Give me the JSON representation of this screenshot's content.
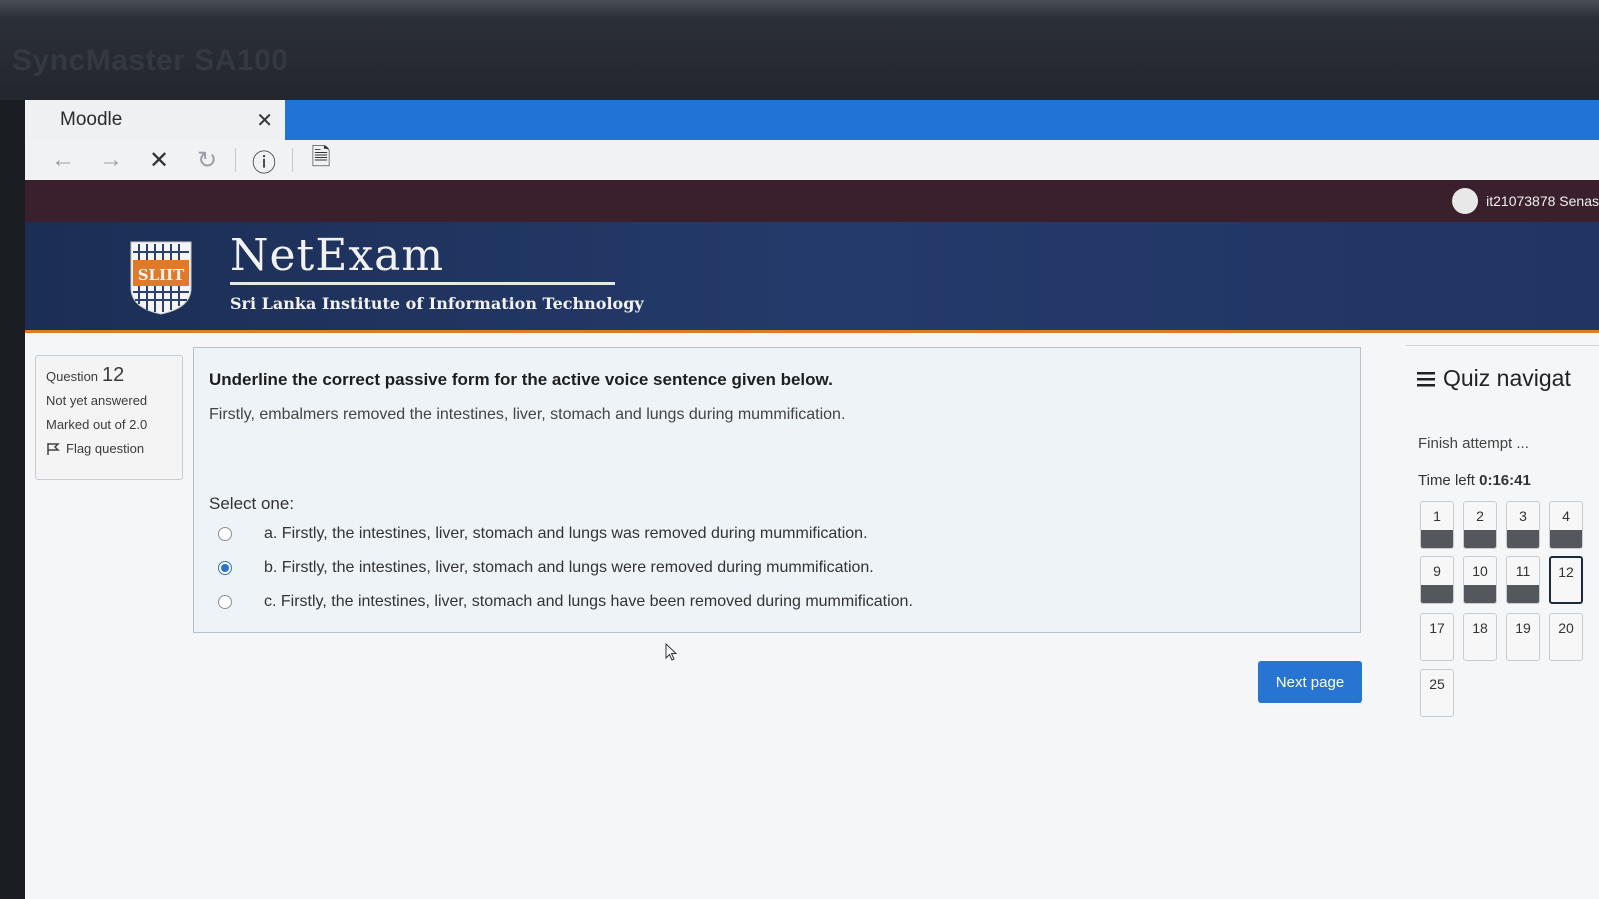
{
  "monitor": {
    "brand": "SyncMaster SA100"
  },
  "browser": {
    "tab_title": "Moodle",
    "tab_close": "✕",
    "nav": {
      "back": "←",
      "forward": "→",
      "stop": "✕",
      "reload": "↻",
      "info": "ⓘ",
      "page": "🗎"
    }
  },
  "userbar": {
    "username": "it21073878 Senas"
  },
  "header": {
    "site_title": "NetExam",
    "site_subtitle": "Sri Lanka Institute of Information Technology",
    "logo_text": "SLIIT"
  },
  "question_info": {
    "label": "Question",
    "number": "12",
    "state": "Not yet answered",
    "grade": "Marked out of 2.0",
    "flag_label": "Flag question"
  },
  "question": {
    "prompt": "Underline the correct passive form for the active voice sentence given below.",
    "sentence": "Firstly, embalmers removed the intestines, liver, stomach and lungs during mummification.",
    "select_label": "Select one:",
    "options": [
      {
        "text": "a. Firstly, the intestines, liver, stomach and lungs was removed during mummification.",
        "selected": false
      },
      {
        "text": "b. Firstly, the intestines, liver, stomach and lungs were removed during mummification.",
        "selected": true
      },
      {
        "text": "c. Firstly, the intestines, liver, stomach and lungs have been removed during mummification.",
        "selected": false
      }
    ]
  },
  "next_button": "Next page",
  "quiz_nav": {
    "title": "Quiz navigat",
    "finish": "Finish attempt ...",
    "time_label": "Time left",
    "time_value": "0:16:41",
    "buttons": [
      {
        "label": "1",
        "answered": true
      },
      {
        "label": "2",
        "answered": true
      },
      {
        "label": "3",
        "answered": true
      },
      {
        "label": "4",
        "answered": true
      },
      {
        "label": "9",
        "answered": true
      },
      {
        "label": "10",
        "answered": true
      },
      {
        "label": "11",
        "answered": true
      },
      {
        "label": "12",
        "answered": false,
        "current": true
      },
      {
        "label": "17",
        "answered": false
      },
      {
        "label": "18",
        "answered": false
      },
      {
        "label": "19",
        "answered": false
      },
      {
        "label": "20",
        "answered": false
      },
      {
        "label": "25",
        "answered": false
      }
    ]
  }
}
